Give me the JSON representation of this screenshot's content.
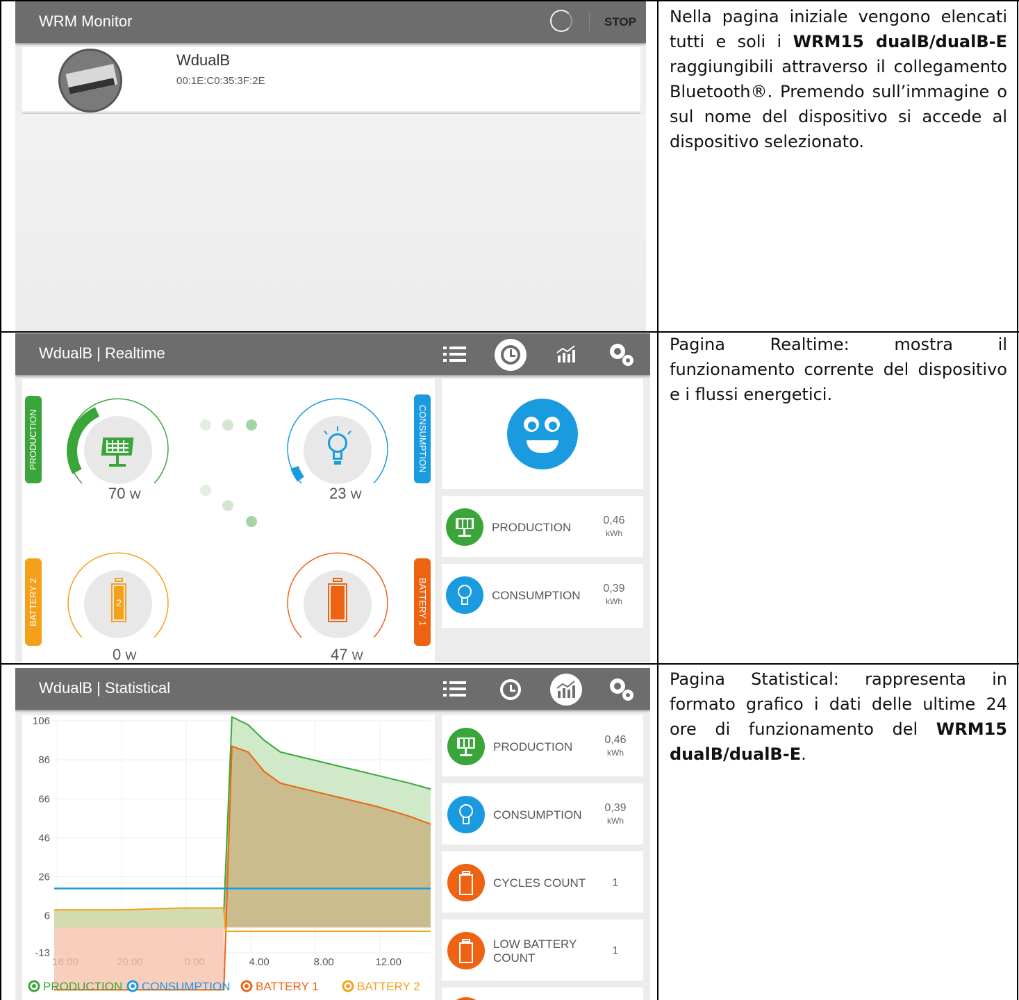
{
  "rows": [
    {
      "description": [
        "Nella pagina iniziale vengono elencati tutti e soli i ",
        "WRM15 dualB/dualB-E",
        " raggiungibili attraverso il collegamento Bluetooth®. Premendo sull’immagine o sul nome del dispositivo si accede al dispositivo selezionato."
      ],
      "screen": {
        "title": "WRM Monitor",
        "stop_label": "STOP",
        "device_name": "WdualB",
        "device_mac": "00:1E:C0:35:3F:2E"
      }
    },
    {
      "description": [
        "Pagina Realtime: mostra il funzionamento corrente del dispositivo e i flussi energetici."
      ],
      "screen": {
        "title": "WdualB | Realtime",
        "production_tab": "PRODUCTION",
        "consumption_tab": "CONSUMPTION",
        "battery2_tab": "BATTERY 2",
        "battery1_tab": "BATTERY 1",
        "production_watt": "70",
        "consumption_watt": "23",
        "battery2_watt": "0",
        "battery1_watt": "47",
        "watt_unit": "W",
        "battery2_number": "2",
        "production_gauge": 0.7,
        "consumption_gauge": 0.23,
        "stats": [
          {
            "label": "PRODUCTION",
            "value": "0,46",
            "unit": "kWh"
          },
          {
            "label": "CONSUMPTION",
            "value": "0,39",
            "unit": "kWh"
          }
        ]
      }
    },
    {
      "description": [
        "Pagina Statistical: rappresenta in formato grafico i dati delle ultime 24 ore di funzionamento del ",
        "WRM15 dualB/dualB-E",
        "."
      ],
      "screen": {
        "title": "WdualB | Statistical",
        "stats": [
          {
            "label": "PRODUCTION",
            "value": "0,46",
            "unit": "kWh"
          },
          {
            "label": "CONSUMPTION",
            "value": "0,39",
            "unit": "kWh"
          },
          {
            "label": "CYCLES COUNT",
            "value": "1",
            "unit": ""
          },
          {
            "label": "LOW BATTERY COUNT",
            "value": "1",
            "unit": ""
          }
        ]
      }
    }
  ],
  "colors": {
    "production": "#3aa63a",
    "consumption": "#1a9be0",
    "battery1": "#ee6312",
    "battery2": "#f5a01a",
    "appbar": "#6d6d6d"
  },
  "chart_data": {
    "type": "line",
    "ytick_labels": [
      "106",
      "86",
      "66",
      "46",
      "26",
      "6",
      "-13"
    ],
    "xtick_labels": [
      "16.00",
      "20.00",
      "0.00",
      "4.00",
      "8.00",
      "12.00"
    ],
    "ylim": [
      -13,
      106
    ],
    "x_hours_from_16": [
      0,
      4,
      8,
      10.5,
      11,
      12,
      13,
      14,
      16,
      18,
      20,
      22,
      23.3
    ],
    "series": [
      {
        "name": "PRODUCTION",
        "values": [
          null,
          null,
          null,
          null,
          108,
          104,
          96,
          90,
          86,
          82,
          78,
          74,
          71
        ]
      },
      {
        "name": "CONSUMPTION",
        "values": [
          20,
          20,
          20,
          20,
          20,
          20,
          20,
          20,
          20,
          20,
          20,
          20,
          20
        ]
      },
      {
        "name": "BATTERY 1",
        "values": [
          -32,
          -32,
          -32,
          -32,
          93,
          90,
          80,
          74,
          70,
          66,
          62,
          57,
          53
        ]
      },
      {
        "name": "BATTERY 2",
        "values": [
          9,
          9,
          10,
          10,
          -2,
          -2,
          -2,
          -2,
          -2,
          -2,
          -2,
          -2,
          -2
        ]
      }
    ],
    "legend": "bottom"
  }
}
